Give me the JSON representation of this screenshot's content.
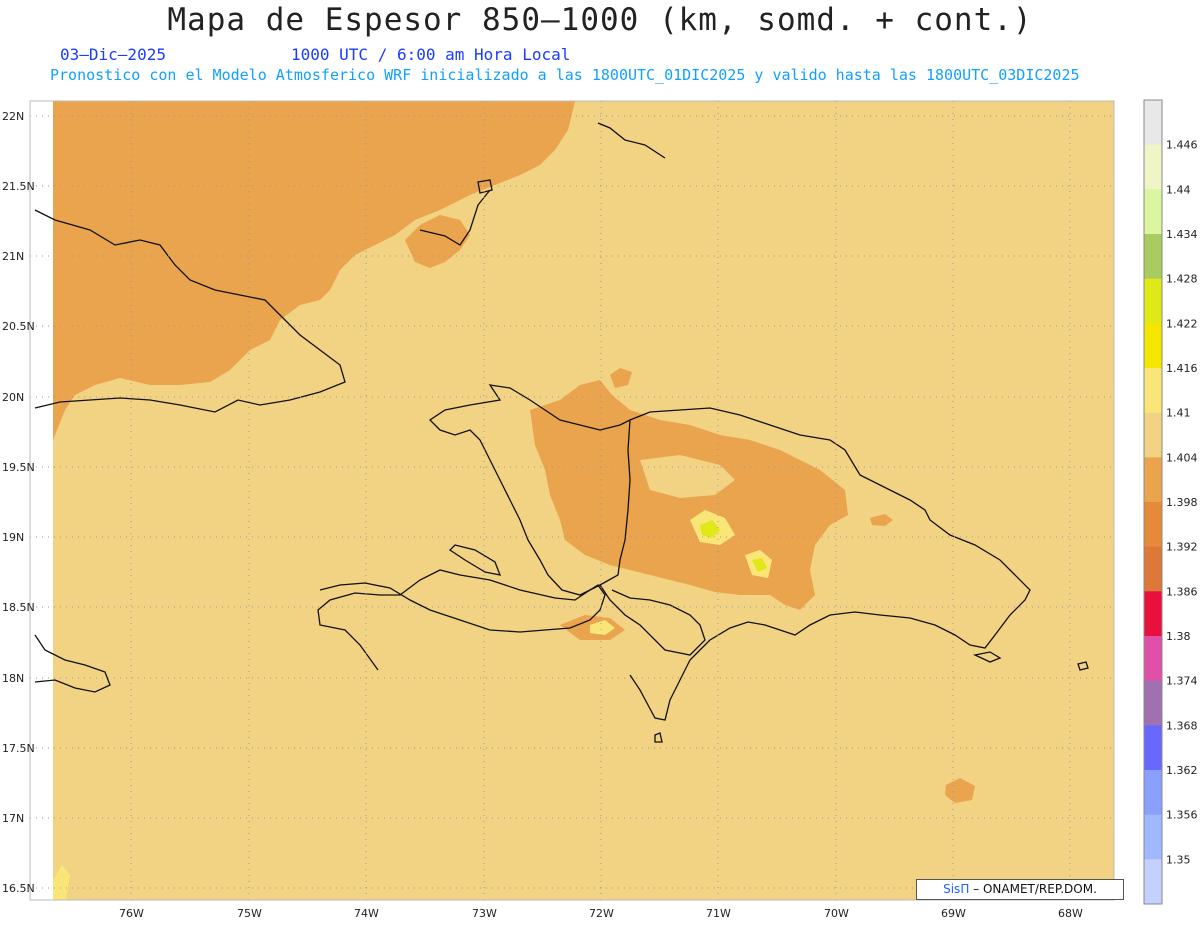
{
  "header": {
    "title": "Mapa de Espesor 850–1000 (km, somd. + cont.)",
    "date": "03–Dic–2025",
    "time": "1000 UTC / 6:00 am Hora Local",
    "forecast": "Pronostico con el Modelo Atmosferico WRF inicializado a las 1800UTC_01DIC2025 y valido hasta las  1800UTC_03DIC2025"
  },
  "axes": {
    "lat_labels": [
      "22N",
      "21.5N",
      "21N",
      "20.5N",
      "20N",
      "19.5N",
      "19N",
      "18.5N",
      "18N",
      "17.5N",
      "17N",
      "16.5N"
    ],
    "lon_labels": [
      "76W",
      "75W",
      "74W",
      "73W",
      "72W",
      "71W",
      "70W",
      "69W",
      "68W"
    ]
  },
  "colorbar": {
    "labels": [
      "1.446",
      "1.44",
      "1.434",
      "1.428",
      "1.422",
      "1.416",
      "1.41",
      "1.404",
      "1.398",
      "1.392",
      "1.386",
      "1.38",
      "1.374",
      "1.368",
      "1.362",
      "1.356",
      "1.35"
    ],
    "colors": [
      "#e8e8e8",
      "#f0f5c8",
      "#dcf5a0",
      "#a8cc60",
      "#e0e818",
      "#f5e600",
      "#fae678",
      "#f2d283",
      "#eaa44e",
      "#e48a3a",
      "#dc7838",
      "#e8103c",
      "#e050a8",
      "#a070b0",
      "#6868ff",
      "#8aa0ff",
      "#a0b8ff",
      "#c4d0ff"
    ]
  },
  "colors": {
    "ocean_field": "#f2d283",
    "land_orange": "#eaa44e",
    "yellow_peak": "#e0e818",
    "coast": "#111111"
  },
  "credit": {
    "logo": "SisΠ",
    "text": "– ONAMET/REP.DOM."
  }
}
